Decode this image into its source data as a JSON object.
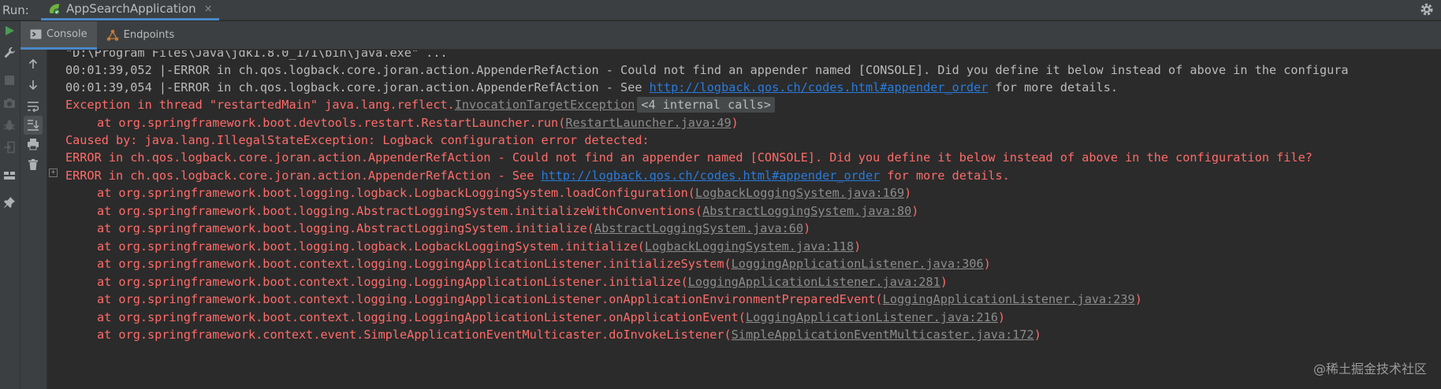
{
  "header": {
    "run_label": "Run:",
    "tab_title": "AppSearchApplication",
    "close_glyph": "×"
  },
  "subtabs": [
    {
      "label": "Console",
      "icon": "console-icon"
    },
    {
      "label": "Endpoints",
      "icon": "endpoints-icon"
    }
  ],
  "colors": {
    "error": "#ff6b68",
    "link": "#287bde",
    "accent": "#4a88c7",
    "run_green": "#499c54"
  },
  "console": {
    "command": "\"D:\\Program Files\\Java\\jdk1.8.0_171\\bin\\java.exe\" ...",
    "log1": "00:01:39,052 |-ERROR in ch.qos.logback.core.joran.action.AppenderRefAction - Could not find an appender named [CONSOLE]. Did you define it below instead of above in the configura",
    "log2_pre": "00:01:39,054 |-ERROR in ch.qos.logback.core.joran.action.AppenderRefAction - See ",
    "log2_link": "http://logback.qos.ch/codes.html#appender_order",
    "log2_post": " for more details.",
    "exc_pre": "Exception in thread \"restartedMain\" java.lang.reflect.",
    "exc_link": "InvocationTargetException",
    "exc_internal": "<4 internal calls>",
    "at1_pre": "at org.springframework.boot.devtools.restart.RestartLauncher.run(",
    "at1_src": "RestartLauncher.java:49",
    "at1_post": ")",
    "caused": "Caused by: java.lang.IllegalStateException: Logback configuration error detected:",
    "err1": "ERROR in ch.qos.logback.core.joran.action.AppenderRefAction - Could not find an appender named [CONSOLE]. Did you define it below instead of above in the configuration file?",
    "err2_pre": "ERROR in ch.qos.logback.core.joran.action.AppenderRefAction - See ",
    "err2_link": "http://logback.qos.ch/codes.html#appender_order",
    "err2_post": " for more details.",
    "frames": [
      {
        "pre": "at org.springframework.boot.logging.logback.LogbackLoggingSystem.loadConfiguration(",
        "src": "LogbackLoggingSystem.java:169",
        "post": ")"
      },
      {
        "pre": "at org.springframework.boot.logging.AbstractLoggingSystem.initializeWithConventions(",
        "src": "AbstractLoggingSystem.java:80",
        "post": ")"
      },
      {
        "pre": "at org.springframework.boot.logging.AbstractLoggingSystem.initialize(",
        "src": "AbstractLoggingSystem.java:60",
        "post": ")"
      },
      {
        "pre": "at org.springframework.boot.logging.logback.LogbackLoggingSystem.initialize(",
        "src": "LogbackLoggingSystem.java:118",
        "post": ")"
      },
      {
        "pre": "at org.springframework.boot.context.logging.LoggingApplicationListener.initializeSystem(",
        "src": "LoggingApplicationListener.java:306",
        "post": ")"
      },
      {
        "pre": "at org.springframework.boot.context.logging.LoggingApplicationListener.initialize(",
        "src": "LoggingApplicationListener.java:281",
        "post": ")"
      },
      {
        "pre": "at org.springframework.boot.context.logging.LoggingApplicationListener.onApplicationEnvironmentPreparedEvent(",
        "src": "LoggingApplicationListener.java:239",
        "post": ")"
      },
      {
        "pre": "at org.springframework.boot.context.logging.LoggingApplicationListener.onApplicationEvent(",
        "src": "LoggingApplicationListener.java:216",
        "post": ")"
      },
      {
        "pre": "at org.springframework.context.event.SimpleApplicationEventMulticaster.doInvokeListener(",
        "src": "SimpleApplicationEventMulticaster.java:172",
        "post": ")"
      }
    ]
  },
  "watermark": "@稀土掘金技术社区"
}
